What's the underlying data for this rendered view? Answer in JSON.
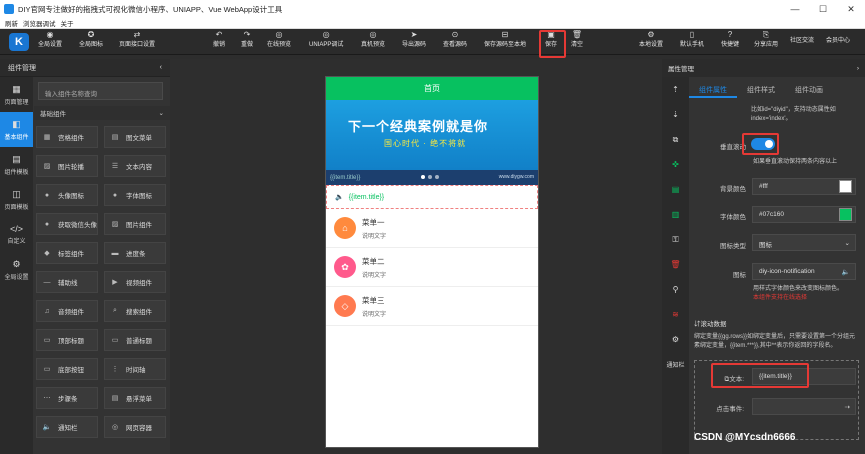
{
  "window": {
    "title": "DIY官网专注做好的拖拽式可视化微信小程序、UNIAPP、Vue WebApp设计工具",
    "menus": [
      "刷新",
      "浏览器调试",
      "关于"
    ]
  },
  "toolbar": {
    "logo": "K",
    "items": [
      {
        "label": "全局设置",
        "icon": "◉"
      },
      {
        "label": "全局图标",
        "icon": "✪"
      },
      {
        "label": "页面接口设置",
        "icon": "⇄"
      },
      {
        "label": "撤销",
        "icon": "↶"
      },
      {
        "label": "重做",
        "icon": "↷"
      },
      {
        "label": "在线预览",
        "icon": "◎"
      },
      {
        "label": "UNIAPP调试",
        "icon": "◎"
      },
      {
        "label": "真机预览",
        "icon": "◎"
      },
      {
        "label": "导出源码",
        "icon": "➤"
      },
      {
        "label": "查看源码",
        "icon": "⊙"
      },
      {
        "label": "保存源码至本地",
        "icon": "⊟"
      },
      {
        "label": "保存",
        "icon": "▣"
      },
      {
        "label": "清空",
        "icon": "🗑"
      },
      {
        "label": "本地设置",
        "icon": "⚙"
      },
      {
        "label": "默认手机",
        "icon": "▯"
      },
      {
        "label": "快捷键",
        "icon": "?"
      },
      {
        "label": "分享应用",
        "icon": "⎘"
      },
      {
        "label": "社区交流",
        "icon": ""
      },
      {
        "label": "会员中心",
        "icon": ""
      }
    ]
  },
  "left": {
    "title": "组件管理",
    "collapse": "‹",
    "tabs": [
      {
        "label": "页面管理",
        "icon": "▦"
      },
      {
        "label": "基本组件",
        "icon": "◧"
      },
      {
        "label": "组件模板",
        "icon": "▤"
      },
      {
        "label": "页面模板",
        "icon": "◫"
      },
      {
        "label": "自定义",
        "icon": "</>"
      },
      {
        "label": "全局设置",
        "icon": "⚙"
      }
    ],
    "search_placeholder": "输入组件名称查询",
    "group": "基础组件",
    "group_toggle": "⌄",
    "components": [
      {
        "label": "宫格组件",
        "icon": "▦"
      },
      {
        "label": "图文菜单",
        "icon": "▤"
      },
      {
        "label": "图片轮播",
        "icon": "▨"
      },
      {
        "label": "文本内容",
        "icon": "☰"
      },
      {
        "label": "头像图标",
        "icon": "●"
      },
      {
        "label": "字体图标",
        "icon": "●"
      },
      {
        "label": "获取微信头像",
        "icon": "●"
      },
      {
        "label": "图片组件",
        "icon": "▨"
      },
      {
        "label": "标签组件",
        "icon": "◆"
      },
      {
        "label": "进度条",
        "icon": "▬"
      },
      {
        "label": "辅助线",
        "icon": "—"
      },
      {
        "label": "视频组件",
        "icon": "▶"
      },
      {
        "label": "音频组件",
        "icon": "♫"
      },
      {
        "label": "搜索组件",
        "icon": "⌕"
      },
      {
        "label": "顶部标题",
        "icon": "▭"
      },
      {
        "label": "普通标题",
        "icon": "▭"
      },
      {
        "label": "底部按钮",
        "icon": "▭"
      },
      {
        "label": "时间轴",
        "icon": "⋮"
      },
      {
        "label": "步骤条",
        "icon": "⋯"
      },
      {
        "label": "悬浮菜单",
        "icon": "▤"
      },
      {
        "label": "通知栏",
        "icon": "🔈"
      },
      {
        "label": "网页容器",
        "icon": "◎"
      }
    ]
  },
  "phone": {
    "title": "首页",
    "banner_text": "下一个经典案例就是你",
    "banner_sub": "国心时代 · 绝不将就",
    "banner_caption": "{{item.title}}",
    "banner_caption2": "www.diygw.com",
    "notice": "{{item.title}}",
    "notice_icon": "🔈",
    "items": [
      {
        "title": "菜单一",
        "sub": "说明文字",
        "color": "#ff8a3d",
        "icon": "⌂"
      },
      {
        "title": "菜单二",
        "sub": "说明文字",
        "color": "#ff5a8c",
        "icon": "✿"
      },
      {
        "title": "菜单三",
        "sub": "说明文字",
        "color": "#ff7a50",
        "icon": "◇"
      }
    ]
  },
  "right": {
    "title": "属性管理",
    "collapse": "›",
    "tabs": [
      "组件属性",
      "组件样式",
      "组件动画"
    ],
    "vicons": [
      "⇡",
      "⇣",
      "⧉",
      "✜",
      "▤",
      "▥",
      "⚿",
      "🗑",
      "⚲",
      "≋",
      "⚙"
    ],
    "notice_label": "通知栏",
    "hint_top": "比如id=\"diyid\"，支持动态属性如index='index'。",
    "vertical_label": "垂直滚动",
    "vertical_hint": "如果垂直滚动保持两条内容以上",
    "bg_label": "背景颜色",
    "bg_value": "#fff",
    "bg_color": "#ffffff",
    "fc_label": "字体颜色",
    "fc_value": "#07c160",
    "fc_color": "#07c160",
    "type_label": "图标类型",
    "type_value": "图标",
    "type_arrow": "⌄",
    "icon_label": "图标",
    "icon_value": "diy-icon-notification",
    "icon_glyph": "🔈",
    "icon_hint": "用样式字体颜色来改变图标颜色。",
    "icon_hint2": "本组件支持在线选择",
    "icon_hint2_color": "#e53935",
    "section": "⇵滚动数据",
    "section_text": "绑定变量{{gg.rows}}如绑定变量后，只需要设置第一个分组元素绑定变量，{{item.***}},其中**表示你返回的字段名。",
    "text_label": "⧉文本:",
    "text_value": "{{item.title}}",
    "click_label": "点击事件:",
    "click_icon": "⇢"
  },
  "watermark": "CSDN @MYcsdn6666"
}
